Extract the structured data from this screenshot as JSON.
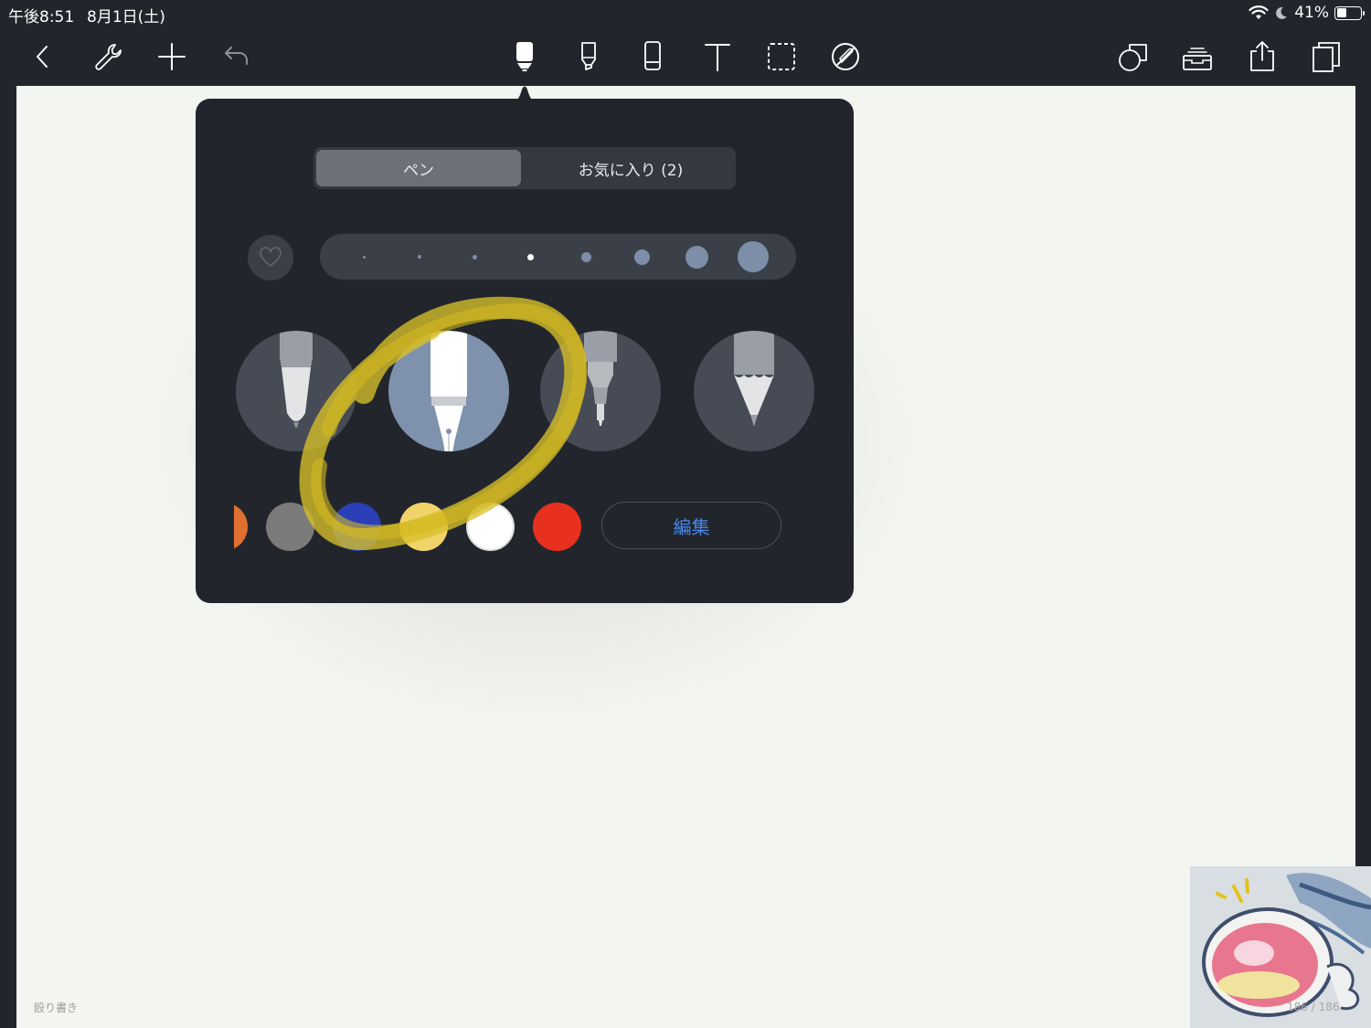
{
  "status_bar": {
    "time": "午後8:51",
    "date": "8月1日(土)",
    "battery_percent": "41%",
    "battery_level": 0.41,
    "wifi_icon": "wifi-icon",
    "moon_icon": "moon-icon"
  },
  "toolbar": {
    "left": [
      "back-icon",
      "wrench-icon",
      "plus-icon",
      "undo-icon"
    ],
    "center": [
      "pen-icon",
      "highlighter-icon",
      "eraser-icon",
      "text-icon",
      "lasso-icon",
      "sticker-icon"
    ],
    "right": [
      "shapes-icon",
      "inbox-icon",
      "share-icon",
      "pages-icon"
    ],
    "active_tool": "pen-icon"
  },
  "popover": {
    "tabs": [
      "ペン",
      "お気に入り (2)"
    ],
    "active_tab": "ペン",
    "sizes": {
      "count": 8,
      "selected_index": 3
    },
    "pen_types": [
      "ballpoint",
      "fountain",
      "brush",
      "pencil"
    ],
    "selected_pen": "fountain",
    "colors": [
      "#e07030",
      "#7b7b7b",
      "#2a3fb8",
      "#f2d36a",
      "#ffffff",
      "#e8301e"
    ],
    "edit_label": "編集",
    "highlight_color": "#d9c02a"
  },
  "canvas": {
    "footer_label": "殴り書き",
    "page_count": "186 / 186",
    "background": "#f3f5f0"
  }
}
